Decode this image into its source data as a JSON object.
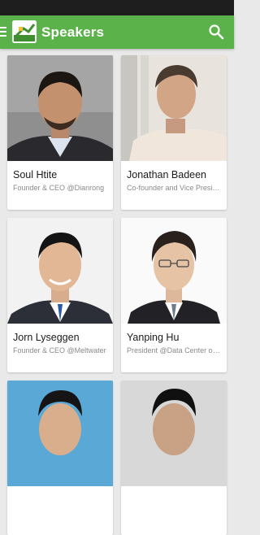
{
  "app_bar": {
    "title": "Speakers",
    "menu_icon": "hamburger-menu-icon",
    "search_icon": "search-icon",
    "accent_color": "#5cb24a"
  },
  "speakers": [
    {
      "name": "Soul Htite",
      "role": "Founder & CEO @Dianrong"
    },
    {
      "name": "Jonathan Badeen",
      "role": "Co-founder and Vice President"
    },
    {
      "name": "Jorn Lyseggen",
      "role": "Founder & CEO @Meltwater"
    },
    {
      "name": "Yanping Hu",
      "role": "President @Data Center of China"
    }
  ]
}
